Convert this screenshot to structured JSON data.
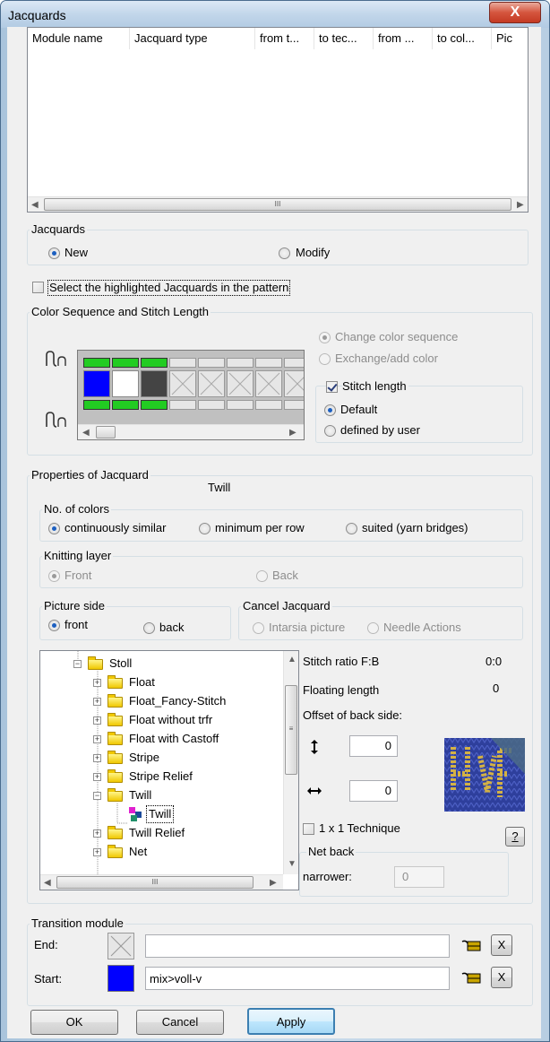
{
  "window": {
    "title": "Jacquards",
    "close_glyph": "X"
  },
  "module_list": {
    "columns": [
      "Module name",
      "Jacquard type",
      "from t...",
      "to tec...",
      "from ...",
      "to col...",
      "Pic"
    ],
    "scroll_thumb": "III"
  },
  "jacquards_group": {
    "label": "Jacquards",
    "new": "New",
    "modify": "Modify",
    "selected": "New"
  },
  "select_highlighted": {
    "label": "Select the highlighted Jacquards in the pattern",
    "checked": false
  },
  "color_sequence": {
    "label": "Color Sequence and Stitch Length",
    "change_color_sequence": "Change color sequence",
    "exchange_add_color": "Exchange/add color",
    "stitch_length": "Stitch length",
    "stitch_length_checked": true,
    "default": "Default",
    "defined_by_user": "defined by user",
    "stitch_length_choice": "Default",
    "grid_colors": {
      "green": "#22cc22",
      "blue": "#0000ff",
      "white": "#ffffff",
      "dark": "#444444"
    }
  },
  "properties": {
    "label": "Properties of Jacquard",
    "jacquard_name": "Twill",
    "no_of_colors": {
      "label": "No. of colors",
      "continuously_similar": "continuously similar",
      "minimum_per_row": "minimum per row",
      "suited": "suited (yarn bridges)",
      "selected": "continuously similar"
    },
    "knitting_layer": {
      "label": "Knitting layer",
      "front": "Front",
      "back": "Back",
      "selected": "Front"
    },
    "picture_side": {
      "label": "Picture side",
      "front": "front",
      "back": "back",
      "selected": "front"
    },
    "cancel_jacquard": {
      "label": "Cancel Jacquard",
      "intarsia_picture": "Intarsia picture",
      "needle_actions": "Needle Actions"
    }
  },
  "tree": {
    "items": [
      {
        "label": "Stoll",
        "level": 0,
        "expanded": true
      },
      {
        "label": "Float",
        "level": 1
      },
      {
        "label": "Float_Fancy-Stitch",
        "level": 1
      },
      {
        "label": "Float without trfr",
        "level": 1
      },
      {
        "label": "Float with Castoff",
        "level": 1
      },
      {
        "label": "Stripe",
        "level": 1
      },
      {
        "label": "Stripe Relief",
        "level": 1
      },
      {
        "label": "Twill",
        "level": 1,
        "expanded": true
      },
      {
        "label": "Twill",
        "level": 2,
        "selected": true
      },
      {
        "label": "Twill Relief",
        "level": 1
      },
      {
        "label": "Net",
        "level": 1
      }
    ],
    "scroll_thumb": "III"
  },
  "stitch_info": {
    "stitch_ratio_label": "Stitch ratio F:B",
    "stitch_ratio_value": "0:0",
    "floating_length_label": "Floating length",
    "floating_length_value": "0",
    "offset_label": "Offset of back side:",
    "vertical_offset": "0",
    "horizontal_offset": "0",
    "technique_1x1": "1 x 1 Technique",
    "technique_checked": false,
    "help": "?",
    "net_back": "Net back",
    "narrower_label": "narrower:",
    "narrower_value": "0"
  },
  "transition_module": {
    "label": "Transition module",
    "end_label": "End:",
    "end_value": "",
    "start_label": "Start:",
    "start_value": "mix>voll-v",
    "start_color": "#0000ff",
    "clear_glyph": "X"
  },
  "buttons": {
    "ok": "OK",
    "cancel": "Cancel",
    "apply": "Apply"
  }
}
